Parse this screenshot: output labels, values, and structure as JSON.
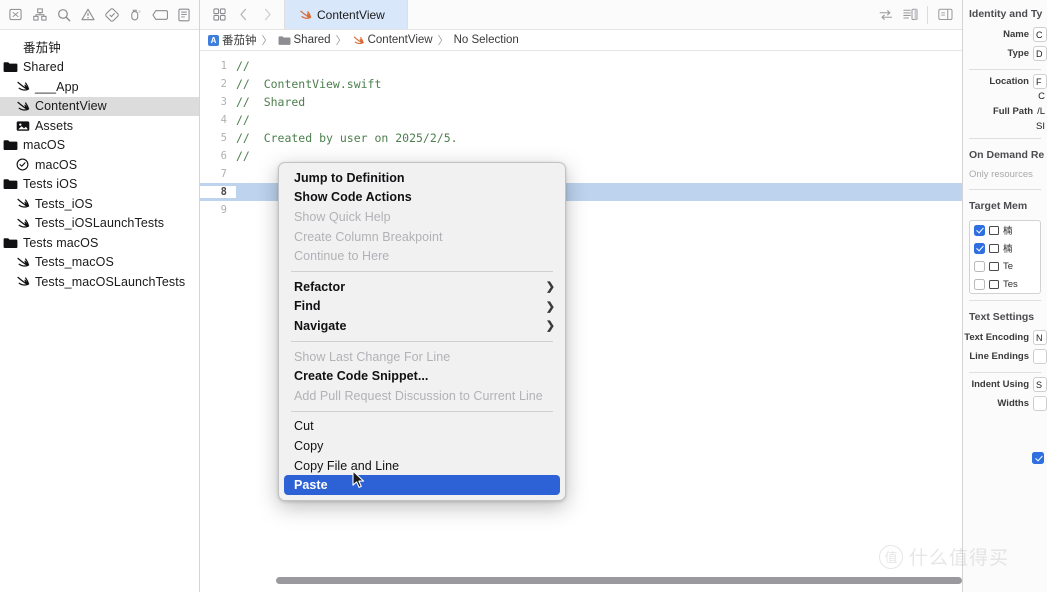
{
  "navigator": {
    "toolbar_icons": [
      {
        "name": "project-navigator-icon",
        "glyph": "folder-grid"
      },
      {
        "name": "source-control-navigator-icon",
        "glyph": "hierarchy"
      },
      {
        "name": "find-navigator-icon",
        "glyph": "search"
      },
      {
        "name": "issue-navigator-icon",
        "glyph": "warning"
      },
      {
        "name": "test-navigator-icon",
        "glyph": "diamond"
      },
      {
        "name": "debug-navigator-icon",
        "glyph": "debug"
      },
      {
        "name": "breakpoint-navigator-icon",
        "glyph": "tag"
      },
      {
        "name": "report-navigator-icon",
        "glyph": "report"
      }
    ],
    "tree": [
      {
        "label": "番茄钟",
        "icon": "project-icon",
        "indent": 0,
        "selected": false,
        "kind": "project"
      },
      {
        "label": "Shared",
        "icon": "folder-icon",
        "indent": 0,
        "selected": false,
        "kind": "folder"
      },
      {
        "label": "___App",
        "icon": "swift-file-icon",
        "indent": 1,
        "selected": false,
        "kind": "swift"
      },
      {
        "label": "ContentView",
        "icon": "swift-file-icon",
        "indent": 1,
        "selected": true,
        "kind": "swift"
      },
      {
        "label": "Assets",
        "icon": "assets-catalog-icon",
        "indent": 1,
        "selected": false,
        "kind": "assets"
      },
      {
        "label": "macOS",
        "icon": "folder-icon",
        "indent": 0,
        "selected": false,
        "kind": "folder"
      },
      {
        "label": "macOS",
        "icon": "entitlements-icon",
        "indent": 1,
        "selected": false,
        "kind": "entitlements"
      },
      {
        "label": "Tests iOS",
        "icon": "folder-icon",
        "indent": 0,
        "selected": false,
        "kind": "folder"
      },
      {
        "label": "Tests_iOS",
        "icon": "swift-file-icon",
        "indent": 1,
        "selected": false,
        "kind": "swift"
      },
      {
        "label": "Tests_iOSLaunchTests",
        "icon": "swift-file-icon",
        "indent": 1,
        "selected": false,
        "kind": "swift"
      },
      {
        "label": "Tests macOS",
        "icon": "folder-icon",
        "indent": 0,
        "selected": false,
        "kind": "folder"
      },
      {
        "label": "Tests_macOS",
        "icon": "swift-file-icon",
        "indent": 1,
        "selected": false,
        "kind": "swift"
      },
      {
        "label": "Tests_macOSLaunchTests",
        "icon": "swift-file-icon",
        "indent": 1,
        "selected": false,
        "kind": "swift"
      }
    ]
  },
  "tabbar": {
    "active_tab": "ContentView",
    "back_label": "‹",
    "forward_label": "›"
  },
  "breadcrumb": {
    "project": "番茄钟",
    "group": "Shared",
    "file": "ContentView",
    "selection": "No Selection",
    "separator": "〉"
  },
  "editor": {
    "lines": [
      {
        "num": "1",
        "text": "//"
      },
      {
        "num": "2",
        "text": "//  ContentView.swift"
      },
      {
        "num": "3",
        "text": "//  Shared"
      },
      {
        "num": "4",
        "text": "//"
      },
      {
        "num": "5",
        "text": "//  Created by user on 2025/2/5."
      },
      {
        "num": "6",
        "text": "//"
      },
      {
        "num": "7",
        "text": ""
      },
      {
        "num": "8",
        "text": "",
        "current": true
      },
      {
        "num": "9",
        "text": ""
      }
    ]
  },
  "context_menu": {
    "groups": [
      {
        "items": [
          {
            "label": "Jump to Definition",
            "state": "enabled",
            "submenu": false
          },
          {
            "label": "Show Code Actions",
            "state": "enabled",
            "submenu": false
          },
          {
            "label": "Show Quick Help",
            "state": "disabled",
            "submenu": false
          },
          {
            "label": "Create Column Breakpoint",
            "state": "disabled",
            "submenu": false
          },
          {
            "label": "Continue to Here",
            "state": "disabled",
            "submenu": false
          }
        ]
      },
      {
        "items": [
          {
            "label": "Refactor",
            "state": "enabled",
            "submenu": true
          },
          {
            "label": "Find",
            "state": "enabled",
            "submenu": true
          },
          {
            "label": "Navigate",
            "state": "enabled",
            "submenu": true
          }
        ]
      },
      {
        "items": [
          {
            "label": "Show Last Change For Line",
            "state": "disabled",
            "submenu": false
          },
          {
            "label": "Create Code Snippet...",
            "state": "enabled",
            "submenu": false
          },
          {
            "label": "Add Pull Request Discussion to Current Line",
            "state": "disabled",
            "submenu": false
          }
        ]
      },
      {
        "items": [
          {
            "label": "Cut",
            "state": "normal",
            "submenu": false
          },
          {
            "label": "Copy",
            "state": "normal",
            "submenu": false
          },
          {
            "label": "Copy File and Line",
            "state": "normal",
            "submenu": false
          },
          {
            "label": "Paste",
            "state": "highlighted",
            "submenu": false
          }
        ]
      }
    ],
    "submenu_arrow": "❯",
    "highlight_color": "#2c62d6"
  },
  "inspector": {
    "identity_title": "Identity and Ty",
    "rows": [
      {
        "label": "Name",
        "value": "C"
      },
      {
        "label": "Type",
        "value": "D"
      }
    ],
    "location_label": "Location",
    "location_value": "F",
    "location_value2": "C",
    "fullpath_label": "Full Path",
    "fullpath_value": "/L",
    "fullpath_value2": "SI",
    "on_demand_title": "On Demand Re",
    "on_demand_placeholder": "Only resources",
    "target_title": "Target Mem",
    "targets": [
      {
        "checked": true,
        "label": "楠",
        "icon": "app-icon"
      },
      {
        "checked": true,
        "label": "楠",
        "icon": "app-icon"
      },
      {
        "checked": false,
        "label": "Te",
        "icon": "test-bundle-icon"
      },
      {
        "checked": false,
        "label": "Tes",
        "icon": "test-bundle-icon"
      }
    ],
    "text_settings_title": "Text Settings",
    "text_rows": [
      {
        "label": "Text Encoding",
        "value": "N"
      },
      {
        "label": "Line Endings",
        "value": ""
      },
      {
        "label": "Indent Using",
        "value": "S"
      },
      {
        "label": "Widths",
        "value": ""
      }
    ]
  },
  "watermark": {
    "mark": "值",
    "text": "什么值得买"
  }
}
